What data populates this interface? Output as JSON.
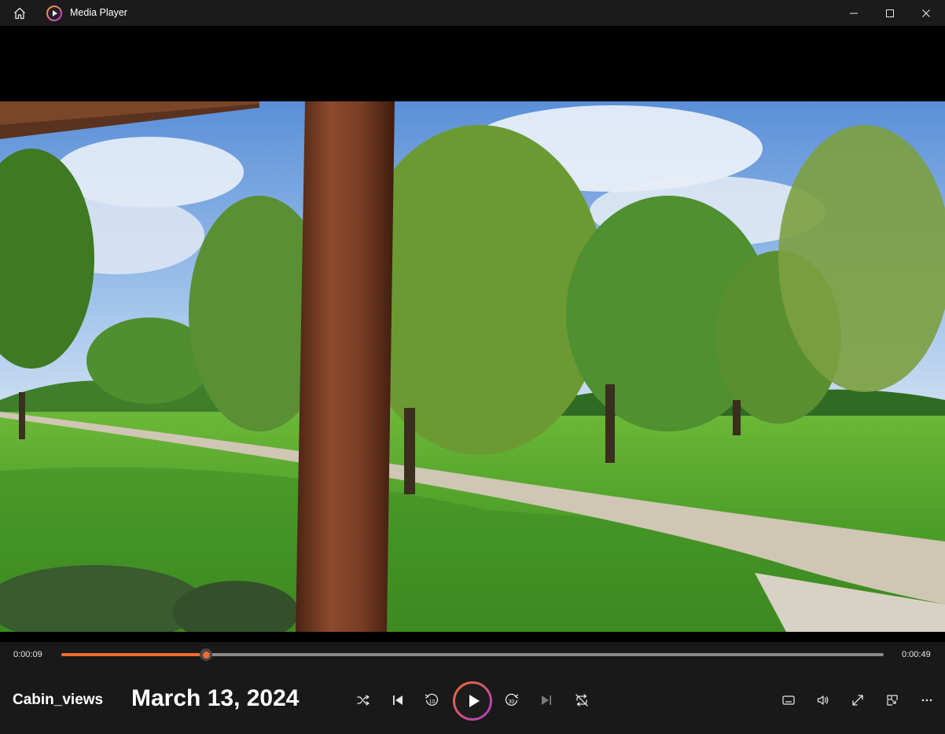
{
  "window": {
    "title": "Media Player",
    "home_icon": "home-icon",
    "app_icon": "media-player-app-icon",
    "minimize_icon": "minimize-icon",
    "maximize_icon": "maximize-icon",
    "close_icon": "close-icon"
  },
  "playback": {
    "current_time": "0:00:09",
    "total_time": "0:00:49",
    "progress": 0.176,
    "state": "paused"
  },
  "media": {
    "title": "Cabin_views",
    "subtitle": "March 13, 2024"
  },
  "controls": {
    "shuffle_icon": "shuffle-icon",
    "previous_icon": "skip-previous-icon",
    "rewind_icon": "rewind-10-icon",
    "rewind_label": "10",
    "play_icon": "play-icon",
    "forward_icon": "forward-30-icon",
    "forward_label": "30",
    "next_icon": "skip-next-icon",
    "repeat_icon": "repeat-off-icon",
    "captions_icon": "captions-icon",
    "volume_icon": "volume-icon",
    "fullscreen_icon": "fullscreen-icon",
    "miniplayer_icon": "mini-player-icon",
    "more_icon": "more-options-icon"
  },
  "colors": {
    "accent": "#f26a2e",
    "play_ring_start": "#f26a2e",
    "play_ring_end": "#a83ec6",
    "titlebar_bg": "#1b1b1b",
    "controls_bg": "#191919"
  }
}
